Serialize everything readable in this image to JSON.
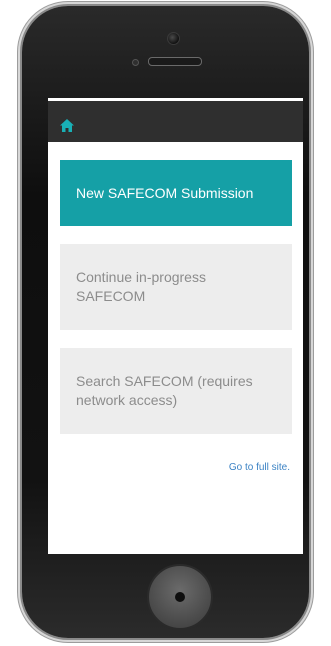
{
  "app": {
    "home_icon": "home-icon"
  },
  "menu": {
    "new_submission": "New SAFECOM Submission",
    "continue_in_progress": "Continue in-progress SAFECOM",
    "search": "Search SAFECOM (requires network access)"
  },
  "footer": {
    "full_site_link": "Go to full site."
  },
  "colors": {
    "accent": "#15a0a6",
    "topbar": "#2f2f2f",
    "tile_secondary": "#ededed",
    "link": "#3b82c4"
  }
}
